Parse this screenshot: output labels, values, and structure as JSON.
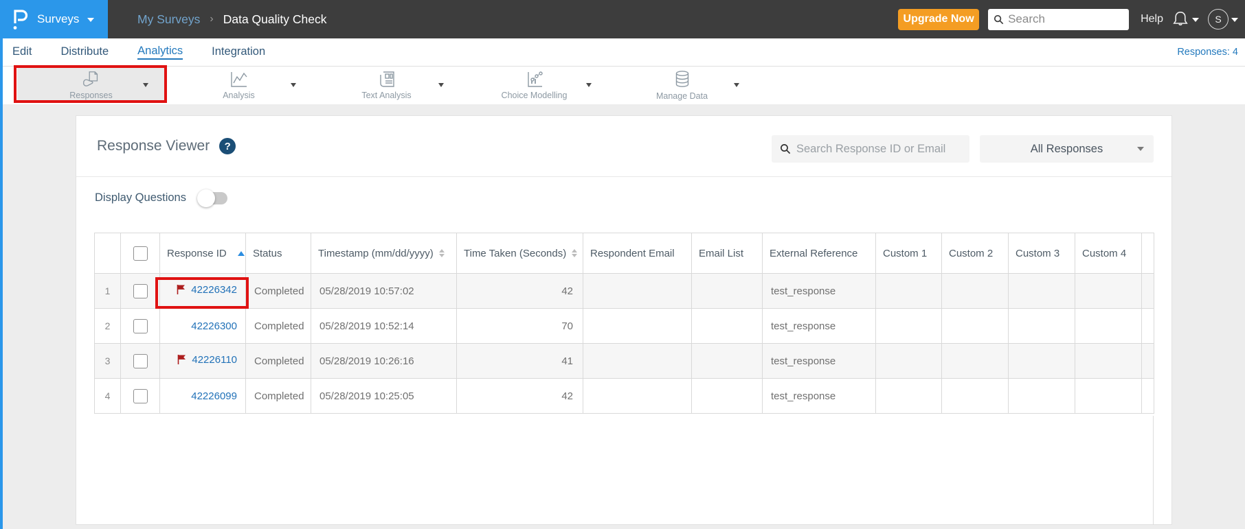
{
  "brand": {
    "logo_letter": "P",
    "product_label": "Surveys"
  },
  "topbar": {
    "breadcrumb_parent": "My Surveys",
    "breadcrumb_separator": "›",
    "breadcrumb_current": "Data Quality Check",
    "upgrade_label": "Upgrade Now",
    "search_placeholder": "Search",
    "help_label": "Help",
    "avatar_initial": "S"
  },
  "nav": {
    "items": [
      {
        "label": "Edit"
      },
      {
        "label": "Distribute"
      },
      {
        "label": "Analytics"
      },
      {
        "label": "Integration"
      }
    ],
    "active_item": "Analytics",
    "responses_count": "Responses: 4"
  },
  "toolbar": {
    "items": [
      {
        "label": "Responses",
        "icon": "responses-icon",
        "active": true
      },
      {
        "label": "Analysis",
        "icon": "analysis-icon",
        "active": false
      },
      {
        "label": "Text Analysis",
        "icon": "text-analysis-icon",
        "active": false
      },
      {
        "label": "Choice Modelling",
        "icon": "choice-modelling-icon",
        "active": false
      },
      {
        "label": "Manage Data",
        "icon": "manage-data-icon",
        "active": false
      }
    ]
  },
  "viewer": {
    "title": "Response Viewer",
    "help_glyph": "?",
    "search_placeholder": "Search Response ID or Email",
    "filter_value": "All Responses",
    "display_questions_label": "Display Questions",
    "display_questions_on": false
  },
  "table": {
    "columns": [
      {
        "label": ""
      },
      {
        "label": ""
      },
      {
        "label": "Response ID",
        "sort": "asc"
      },
      {
        "label": "Status"
      },
      {
        "label": "Timestamp (mm/dd/yyyy)",
        "sort": "both"
      },
      {
        "label": "Time Taken (Seconds)",
        "sort": "both"
      },
      {
        "label": "Respondent Email"
      },
      {
        "label": "Email List"
      },
      {
        "label": "External Reference"
      },
      {
        "label": "Custom 1"
      },
      {
        "label": "Custom 2"
      },
      {
        "label": "Custom 3"
      },
      {
        "label": "Custom 4"
      }
    ],
    "rows": [
      {
        "num": "1",
        "flagged": true,
        "response_id": "42226342",
        "status": "Completed",
        "timestamp": "05/28/2019 10:57:02",
        "time_taken": "42",
        "respondent_email": "",
        "email_list": "",
        "external_reference": "test_response",
        "custom_1": "",
        "custom_2": "",
        "custom_3": "",
        "custom_4": ""
      },
      {
        "num": "2",
        "flagged": false,
        "response_id": "42226300",
        "status": "Completed",
        "timestamp": "05/28/2019 10:52:14",
        "time_taken": "70",
        "respondent_email": "",
        "email_list": "",
        "external_reference": "test_response",
        "custom_1": "",
        "custom_2": "",
        "custom_3": "",
        "custom_4": ""
      },
      {
        "num": "3",
        "flagged": true,
        "response_id": "42226110",
        "status": "Completed",
        "timestamp": "05/28/2019 10:26:16",
        "time_taken": "41",
        "respondent_email": "",
        "email_list": "",
        "external_reference": "test_response",
        "custom_1": "",
        "custom_2": "",
        "custom_3": "",
        "custom_4": ""
      },
      {
        "num": "4",
        "flagged": false,
        "response_id": "42226099",
        "status": "Completed",
        "timestamp": "05/28/2019 10:25:05",
        "time_taken": "42",
        "respondent_email": "",
        "email_list": "",
        "external_reference": "test_response",
        "custom_1": "",
        "custom_2": "",
        "custom_3": "",
        "custom_4": ""
      }
    ]
  },
  "colors": {
    "brand_blue": "#2b97ea",
    "topbar_dark": "#3d3d3d",
    "upgrade_orange": "#f49d23",
    "annotation_red": "#e01212",
    "flag_red": "#ad1e1e",
    "link_blue": "#2272b8"
  }
}
